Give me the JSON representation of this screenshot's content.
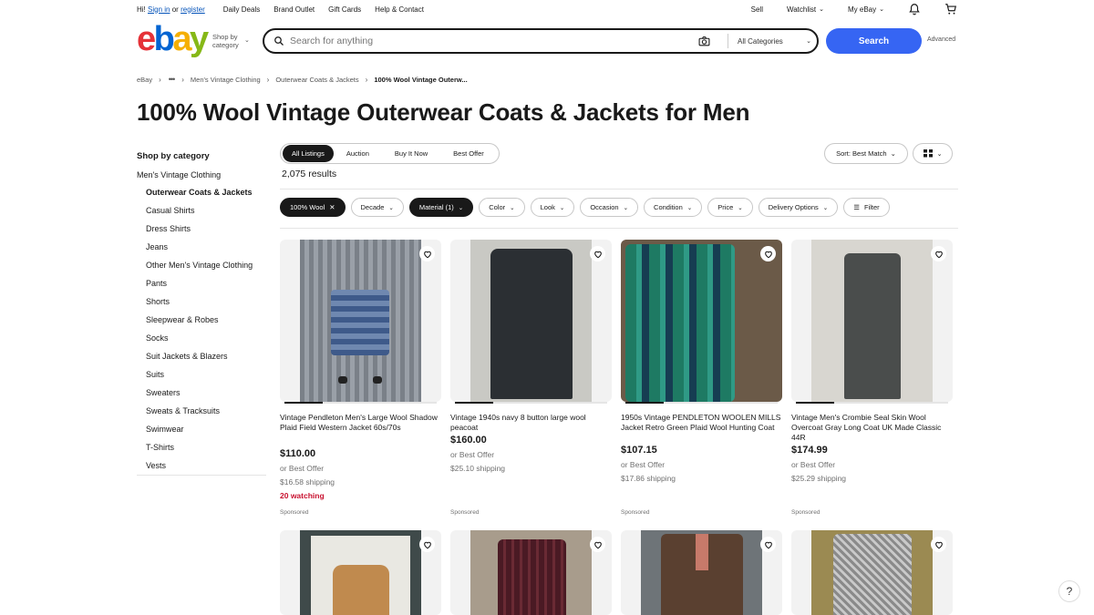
{
  "topbar": {
    "greeting": "Hi!",
    "sign_in": "Sign in",
    "or": "or",
    "register": "register",
    "links": [
      "Daily Deals",
      "Brand Outlet",
      "Gift Cards",
      "Help & Contact"
    ],
    "sell": "Sell",
    "watchlist": "Watchlist",
    "my_ebay": "My eBay"
  },
  "header": {
    "logo": {
      "e": "e",
      "b": "b",
      "a": "a",
      "y": "y"
    },
    "shop_by_line1": "Shop by",
    "shop_by_line2": "category",
    "search_placeholder": "Search for anything",
    "category_select": "All Categories",
    "search_button": "Search",
    "advanced": "Advanced"
  },
  "breadcrumb": {
    "items": [
      "eBay",
      "Men's Vintage Clothing",
      "Outerwear Coats & Jackets",
      "100% Wool Vintage Outerw..."
    ]
  },
  "page_title": "100% Wool Vintage Outerwear Coats & Jackets for Men",
  "sidebar": {
    "header": "Shop by category",
    "parent": "Men's Vintage Clothing",
    "items": [
      "Outerwear Coats & Jackets",
      "Casual Shirts",
      "Dress Shirts",
      "Jeans",
      "Other Men's Vintage Clothing",
      "Pants",
      "Shorts",
      "Sleepwear & Robes",
      "Socks",
      "Suit Jackets & Blazers",
      "Suits",
      "Sweaters",
      "Sweats & Tracksuits",
      "Swimwear",
      "T-Shirts",
      "Vests"
    ]
  },
  "tabs": [
    "All Listings",
    "Auction",
    "Buy It Now",
    "Best Offer"
  ],
  "sort_label": "Sort: Best Match",
  "results_count": "2,075 results",
  "filters": {
    "wool": "100% Wool",
    "decade": "Decade",
    "material": "Material (1)",
    "color": "Color",
    "look": "Look",
    "occasion": "Occasion",
    "condition": "Condition",
    "price": "Price",
    "delivery": "Delivery Options",
    "filter": "Filter"
  },
  "products": [
    {
      "title": "Vintage Pendleton Men's Large Wool Shadow Plaid Field Western Jacket 60s/70s",
      "price": "$110.00",
      "best_offer": "or Best Offer",
      "shipping": "$16.58 shipping",
      "watching": "20 watching",
      "sponsored": "Sponsored"
    },
    {
      "title": "Vintage 1940s navy 8 button large wool peacoat",
      "price": "$160.00",
      "best_offer": "or Best Offer",
      "shipping": "$25.10 shipping",
      "sponsored": "Sponsored"
    },
    {
      "title": "1950s Vintage PENDLETON WOOLEN MILLS Jacket Retro Green Plaid Wool Hunting Coat",
      "price": "$107.15",
      "best_offer": "or Best Offer",
      "shipping": "$17.86 shipping",
      "sponsored": "Sponsored"
    },
    {
      "title": "Vintage Men's Crombie Seal Skin Wool Overcoat Gray Long Coat UK Made Classic 44R",
      "price": "$174.99",
      "best_offer": "or Best Offer",
      "shipping": "$25.29 shipping",
      "sponsored": "Sponsored"
    }
  ],
  "help": "?"
}
